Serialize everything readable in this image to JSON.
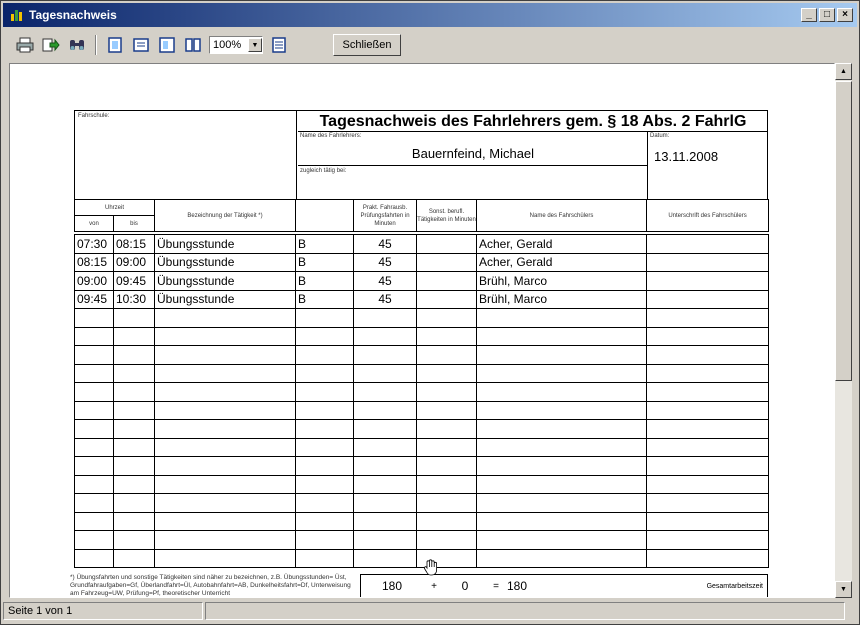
{
  "window": {
    "title": "Tagesnachweis"
  },
  "toolbar": {
    "zoom": "100%",
    "close_label": "Schließen"
  },
  "doc": {
    "fahrschule_label": "Fahrschule:",
    "title": "Tagesnachweis des Fahrlehrers gem. § 18 Abs. 2 FahrlG",
    "name_label": "Name des Fahrlehrers:",
    "name_value": "Bauernfeind, Michael",
    "zugleich_label": "zugleich tätig bei:",
    "datum_label": "Datum:",
    "datum_value": "13.11.2008",
    "col_uhrzeit": "Uhrzeit",
    "col_von": "von",
    "col_bis": "bis",
    "col_bezeichnung": "Bezeichnung der Tätigkeit *)",
    "col_prakt": "Prakt. Fahrausb. Prüfungsfahrten in Minuten",
    "col_sonst": "Sonst. berufl. Tätigkeiten in Minuten",
    "col_name": "Name des Fahrschülers",
    "col_unterschrift": "Unterschrift des Fahrschülers",
    "rows": [
      {
        "von": "07:30",
        "bis": "08:15",
        "taetigkeit": "Übungsstunde",
        "klasse": "B",
        "prakt": "45",
        "sonst": "",
        "schueler": "Acher, Gerald",
        "unterschrift": ""
      },
      {
        "von": "08:15",
        "bis": "09:00",
        "taetigkeit": "Übungsstunde",
        "klasse": "B",
        "prakt": "45",
        "sonst": "",
        "schueler": "Acher, Gerald",
        "unterschrift": ""
      },
      {
        "von": "09:00",
        "bis": "09:45",
        "taetigkeit": "Übungsstunde",
        "klasse": "B",
        "prakt": "45",
        "sonst": "",
        "schueler": "Brühl, Marco",
        "unterschrift": ""
      },
      {
        "von": "09:45",
        "bis": "10:30",
        "taetigkeit": "Übungsstunde",
        "klasse": "B",
        "prakt": "45",
        "sonst": "",
        "schueler": "Brühl, Marco",
        "unterschrift": ""
      }
    ],
    "footnote": "*) Übungsfahrten und sonstige Tätigkeiten sind näher zu bezeichnen, z.B. Übungsstunden= Üst, Grundfahraufgaben=Gf, Überlandfahrt=Ül, Autobahnfahrt=AB, Dunkelheitsfahrt=Df, Unterweisung am Fahrzeug=UW, Prüfung=Pf, theoretischer Unterricht",
    "sum_prakt": "180",
    "sum_plus": "+",
    "sum_sonst": "0",
    "sum_eq": "=",
    "sum_total": "180",
    "gesamt_label": "Gesamtarbeitszeit"
  },
  "status": {
    "page": "Seite 1 von 1"
  }
}
